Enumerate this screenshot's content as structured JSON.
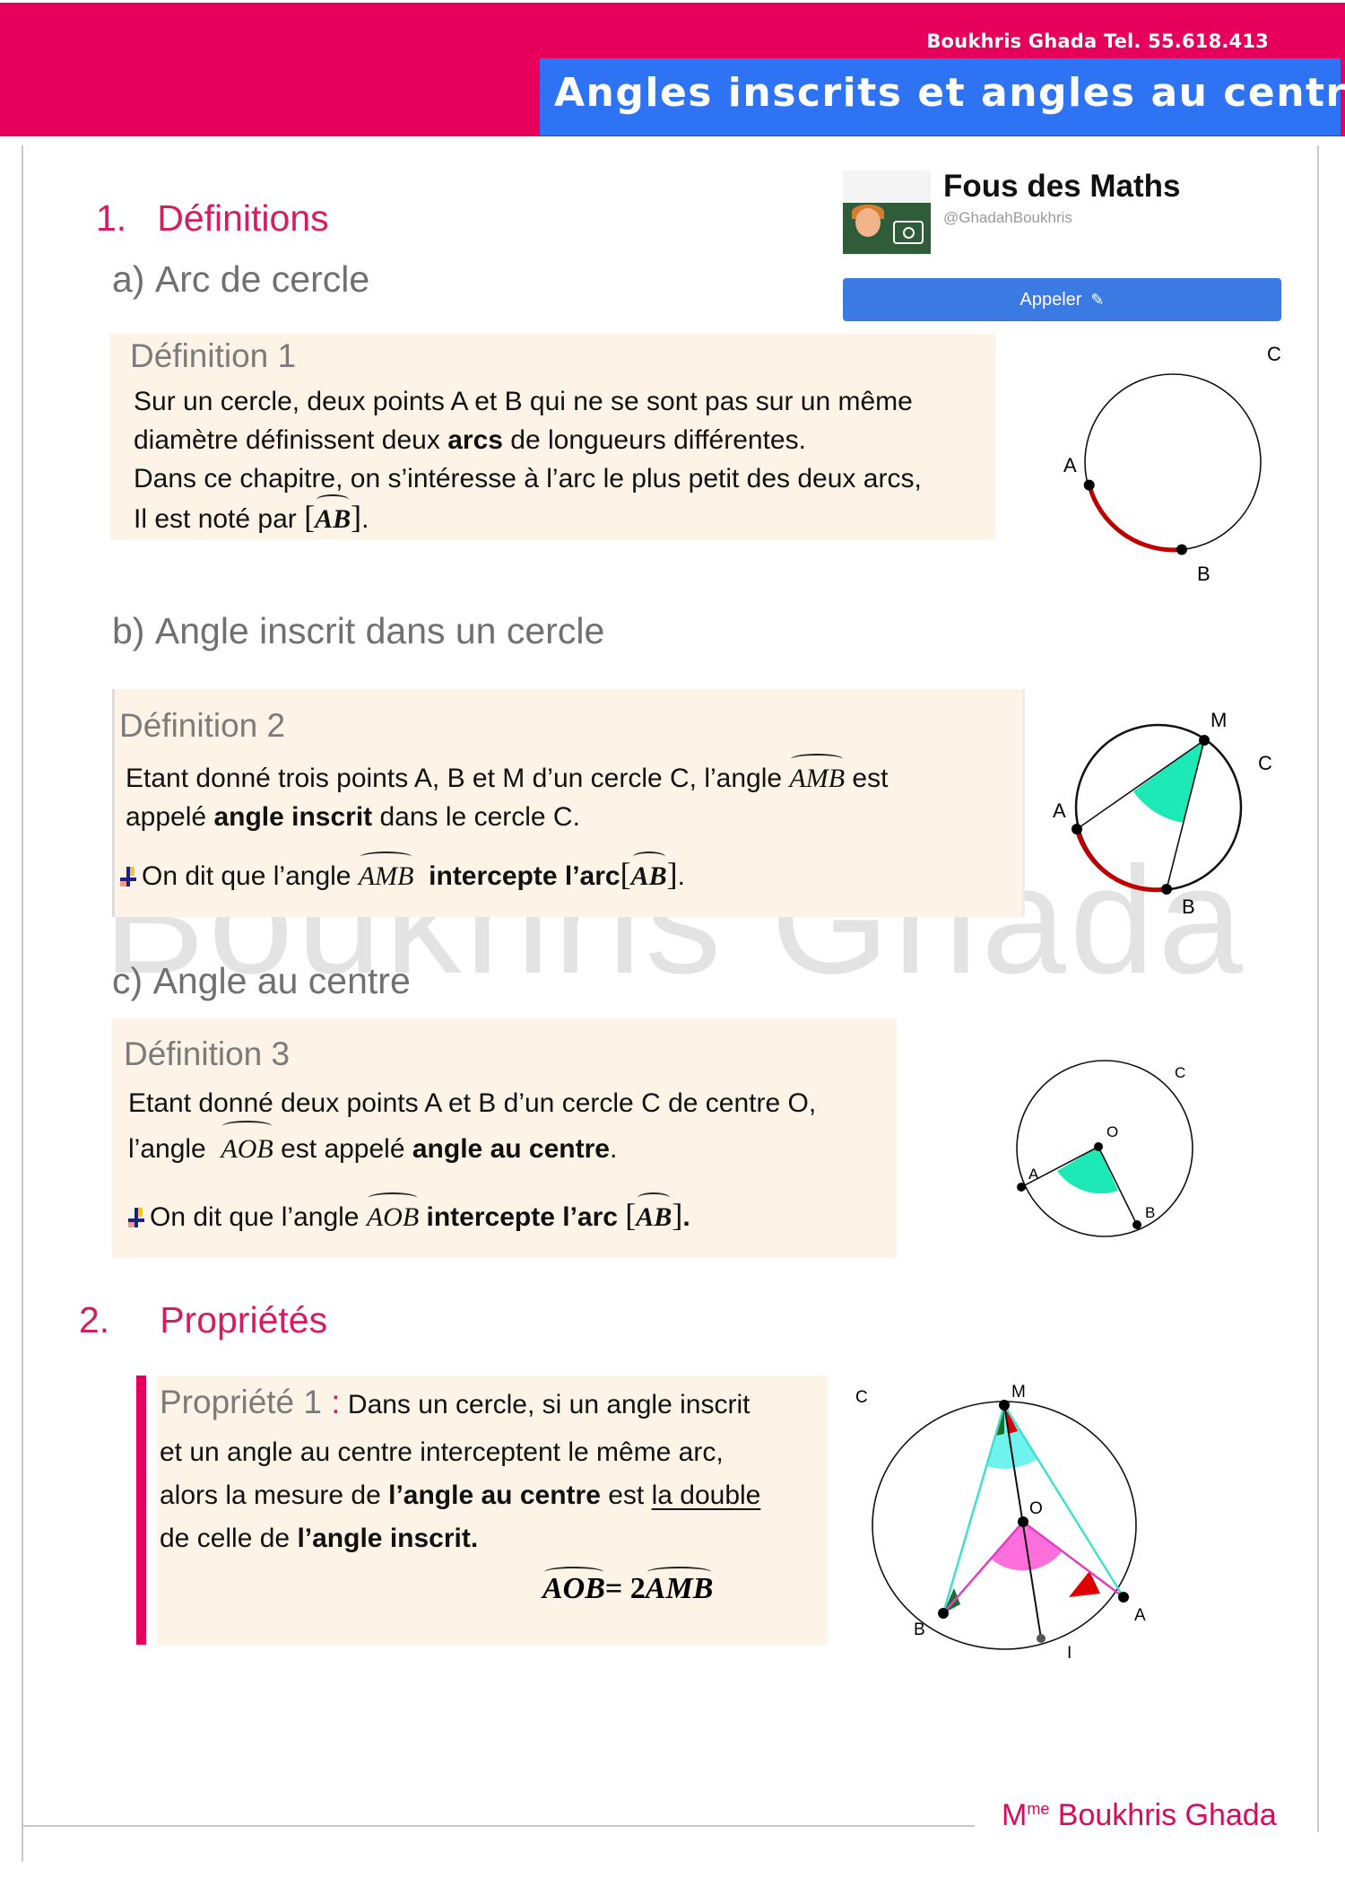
{
  "header": {
    "contact": "Boukhris Ghada  Tel. 55.618.413",
    "title": "Angles inscrits et angles au centre"
  },
  "social_card": {
    "page_name": "Fous des Maths",
    "handle": "@GhadahBoukhris",
    "button_label": "Appeler",
    "button_icon": "pencil-icon",
    "avatar_icon": "camera-icon"
  },
  "watermark": "Boukhris Ghada",
  "sections": [
    {
      "number": "1.",
      "title": "Définitions",
      "subsections": [
        {
          "label": "a)",
          "title": "Arc de cercle",
          "box_title": "Définition 1",
          "lines": [
            "Sur un cercle, deux points A et B qui ne se sont pas sur un  même",
            "diamètre définissent deux ",
            "arcs",
            " de longueurs différentes.",
            "Dans ce chapitre, on s’intéresse à l’arc le plus petit des deux arcs,",
            "Il est noté par "
          ],
          "arc_symbol": "AB",
          "figure": {
            "circle_label": "C",
            "points": [
              "A",
              "B"
            ]
          }
        },
        {
          "label": "b)",
          "title": "Angle inscrit dans un cercle",
          "box_title": "Définition 2",
          "line1": "Etant donné trois points A, B et M d’un cercle C, l’angle ",
          "angle": "AMB",
          "line1_end": "  est",
          "line2_pre": "appelé ",
          "line2_bold": "angle inscrit",
          "line2_post": " dans le cercle C.",
          "note_pre": "On dit que l’angle ",
          "note_bold": "intercepte l’arc",
          "arc": "AB",
          "figure": {
            "circle_label": "C",
            "points": [
              "A",
              "B",
              "M"
            ]
          }
        },
        {
          "label": "c)",
          "title": "Angle au centre",
          "box_title": "Définition 3",
          "line1": "Etant donné deux points A et B d’un cercle C de centre O,",
          "line2_pre": "l’angle ",
          "angle": "AOB",
          "line2_mid": " est appelé ",
          "line2_bold": "angle au centre",
          "line2_post": ".",
          "note_pre": "On dit que l’angle ",
          "note_bold": "intercepte l’arc ",
          "arc": "AB",
          "figure": {
            "circle_label": "C",
            "points": [
              "A",
              "B",
              "O"
            ]
          }
        }
      ]
    },
    {
      "number": "2.",
      "title": "Propriétés",
      "property": {
        "title": "Propriété 1",
        "colon": " :",
        "line1": " Dans un cercle, si un angle inscrit",
        "line2": "et un angle au centre interceptent le même arc,",
        "line3_pre": "alors la mesure de ",
        "line3_bold": "l’angle au centre",
        "line3_mid": " est ",
        "line3_underline": "la double",
        "line4_pre": " de celle de ",
        "line4_bold": "l’angle inscrit.",
        "formula_left": "AOB",
        "formula_eq": " = 2",
        "formula_right": "AMB",
        "figure": {
          "circle_label": "C",
          "points": [
            "M",
            "O",
            "A",
            "B",
            "I"
          ]
        }
      }
    }
  ],
  "footer": {
    "signature_prefix": "M",
    "signature_sup": "me",
    "signature_name": " Boukhris Ghada"
  },
  "colors": {
    "header_pink": "#e6005c",
    "title_blue": "#2f73f5",
    "box_beige": "#fdf3e6",
    "arc_red": "#c00000",
    "angle_cyan": "#1de9b6",
    "angle_magenta": "#ff5fd7"
  }
}
